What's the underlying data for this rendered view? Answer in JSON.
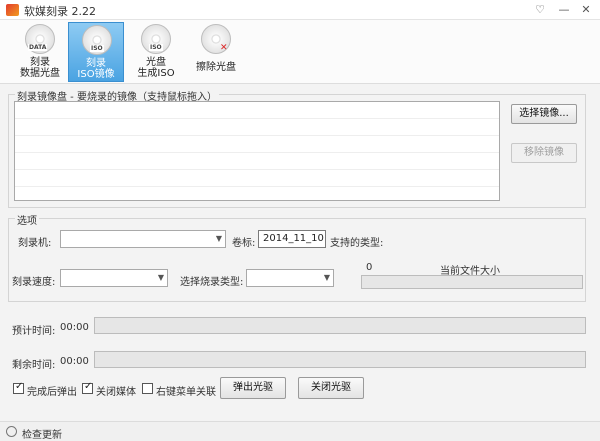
{
  "window": {
    "title": "软媒刻录 2.22",
    "minimize": "—",
    "close": "✕"
  },
  "toolbar": {
    "items": [
      {
        "line1": "刻录",
        "line2": "数据光盘",
        "tag": "DATA"
      },
      {
        "line1": "刻录",
        "line2": "ISO镜像",
        "tag": "ISO"
      },
      {
        "line1": "光盘",
        "line2": "生成ISO",
        "tag": "ISO"
      },
      {
        "line1": "擦除光盘",
        "line2": "",
        "tag": ""
      }
    ],
    "active_index": 1
  },
  "image_group": {
    "title": "刻录镜像盘 - 要烧录的镜像（支持鼠标拖入）",
    "select_button": "选择镜像...",
    "remove_button": "移除镜像"
  },
  "options": {
    "title": "选项",
    "burner_label": "刻录机:",
    "volume_label": "卷标:",
    "volume_value": "2014_11_10",
    "supported_label": "支持的类型:",
    "speed_label": "刻录速度:",
    "burn_type_label": "选择烧录类型:",
    "size_value": "0",
    "size_label": "当前文件大小",
    "size_progress": 0
  },
  "time": {
    "estimated_label": "预计时间:",
    "estimated_value": "00:00",
    "estimated_progress": 0,
    "remaining_label": "剩余时间:",
    "remaining_value": "00:00",
    "remaining_progress": 0
  },
  "bottom": {
    "eject_after": {
      "label": "完成后弹出",
      "checked": true
    },
    "close_media": {
      "label": "关闭媒体",
      "checked": true
    },
    "context_menu": {
      "label": "右键菜单关联",
      "checked": false
    },
    "eject_button": "弹出光驱",
    "close_button": "关闭光驱"
  },
  "status": {
    "update": "检查更新"
  }
}
